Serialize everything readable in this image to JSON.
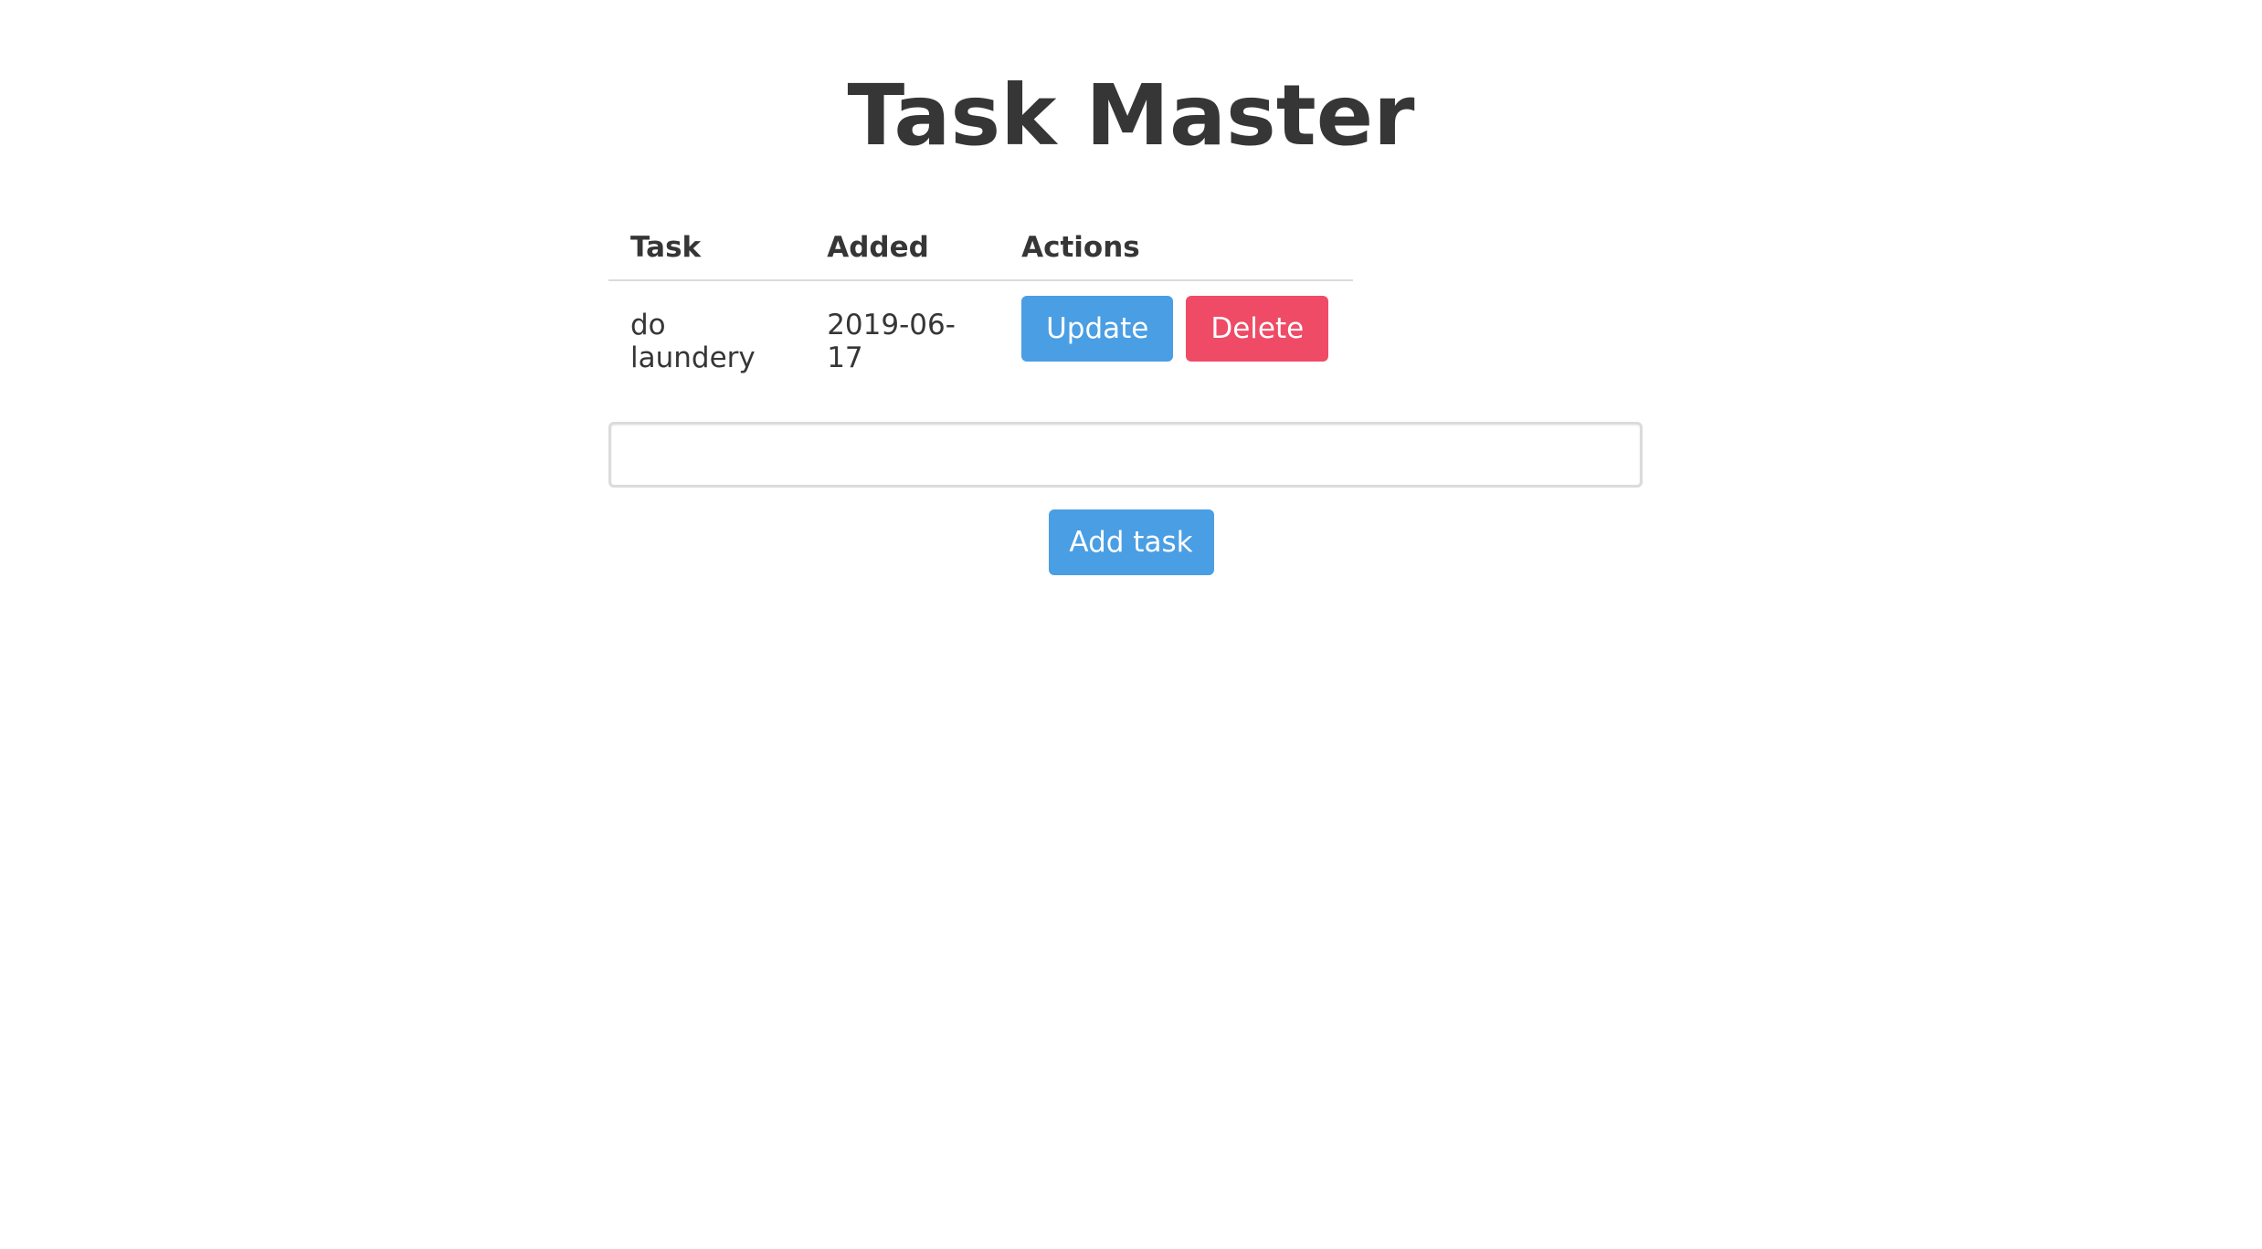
{
  "page": {
    "title": "Task Master"
  },
  "table": {
    "headers": {
      "task": "Task",
      "added": "Added",
      "actions": "Actions"
    },
    "rows": [
      {
        "task": "do laundery",
        "added": "2019-06-17",
        "update_label": "Update",
        "delete_label": "Delete"
      }
    ]
  },
  "form": {
    "input_value": "",
    "input_placeholder": "",
    "add_label": "Add task"
  },
  "colors": {
    "primary_button": "#4a9ee3",
    "danger_button": "#ef4b66",
    "text": "#363636",
    "border": "#dbdbdb"
  }
}
